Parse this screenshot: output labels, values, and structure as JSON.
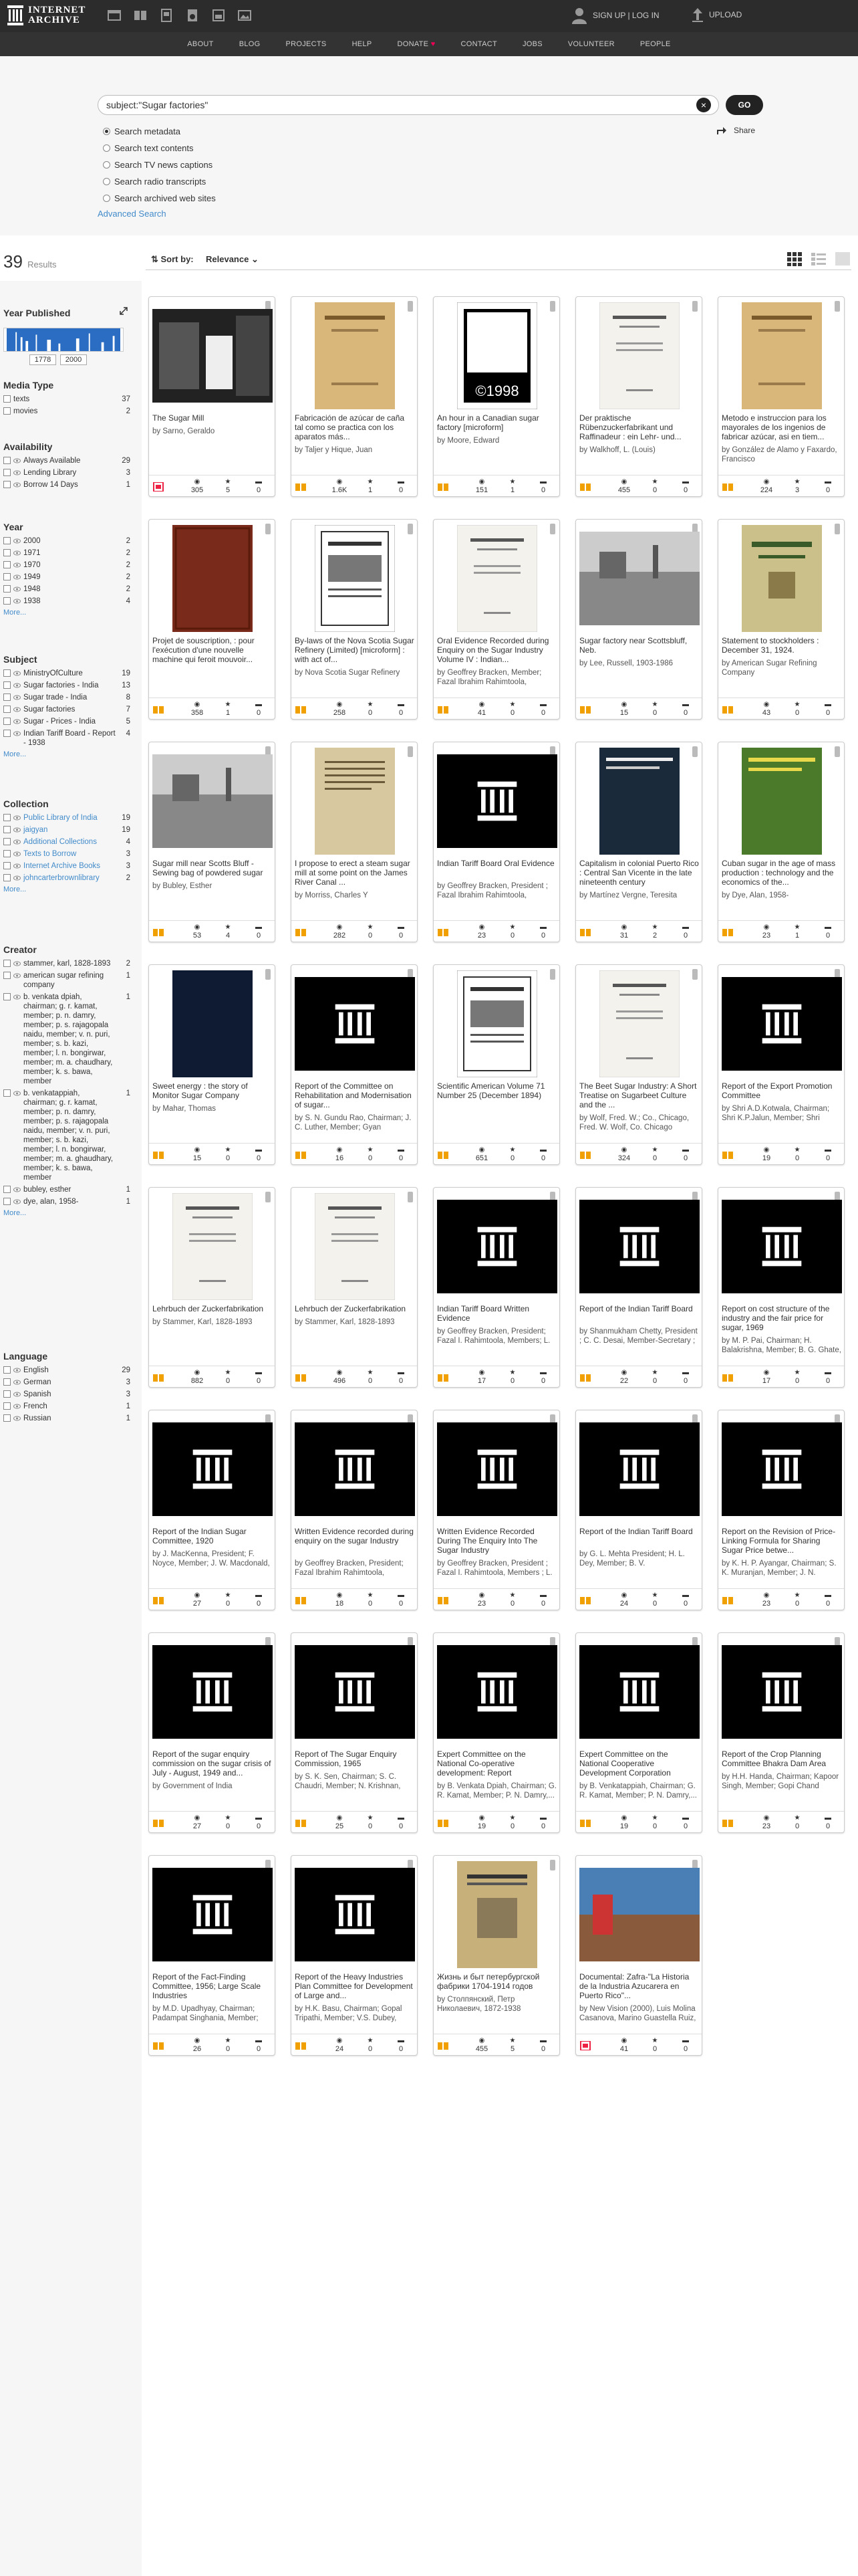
{
  "header": {
    "logo_line1": "INTERNET",
    "logo_line2": "ARCHIVE",
    "signup": "SIGN UP | LOG IN",
    "upload": "UPLOAD",
    "nav": [
      "ABOUT",
      "BLOG",
      "PROJECTS",
      "HELP",
      "DONATE",
      "CONTACT",
      "JOBS",
      "VOLUNTEER",
      "PEOPLE"
    ]
  },
  "search": {
    "query": "subject:\"Sugar factories\"",
    "go": "GO",
    "options": [
      "Search metadata",
      "Search text contents",
      "Search TV news captions",
      "Search radio transcripts",
      "Search archived web sites"
    ],
    "advanced": "Advanced Search",
    "share": "Share"
  },
  "results": {
    "count": "39",
    "label": "Results"
  },
  "sort": {
    "label": "Sort by:",
    "value": "Relevance"
  },
  "facets": {
    "year_published": {
      "title": "Year Published",
      "from": "1778",
      "to": "2000"
    },
    "media_type": {
      "title": "Media Type",
      "items": [
        {
          "label": "texts",
          "count": "37"
        },
        {
          "label": "movies",
          "count": "2"
        }
      ]
    },
    "availability": {
      "title": "Availability",
      "items": [
        {
          "label": "Always Available",
          "count": "29"
        },
        {
          "label": "Lending Library",
          "count": "3"
        },
        {
          "label": "Borrow 14 Days",
          "count": "1"
        }
      ]
    },
    "year": {
      "title": "Year",
      "items": [
        {
          "label": "2000",
          "count": "2"
        },
        {
          "label": "1971",
          "count": "2"
        },
        {
          "label": "1970",
          "count": "2"
        },
        {
          "label": "1949",
          "count": "2"
        },
        {
          "label": "1948",
          "count": "2"
        },
        {
          "label": "1938",
          "count": "4"
        }
      ],
      "more": "More..."
    },
    "subject": {
      "title": "Subject",
      "items": [
        {
          "label": "MinistryOfCulture",
          "count": "19"
        },
        {
          "label": "Sugar factories - India",
          "count": "13"
        },
        {
          "label": "Sugar trade - India",
          "count": "8"
        },
        {
          "label": "Sugar factories",
          "count": "7"
        },
        {
          "label": "Sugar - Prices - India",
          "count": "5"
        },
        {
          "label": "Indian Tariff Board - Report - 1938",
          "count": "4"
        }
      ],
      "more": "More..."
    },
    "collection": {
      "title": "Collection",
      "items": [
        {
          "label": "Public Library of India",
          "count": "19"
        },
        {
          "label": "jaigyan",
          "count": "19"
        },
        {
          "label": "Additional Collections",
          "count": "4"
        },
        {
          "label": "Texts to Borrow",
          "count": "3"
        },
        {
          "label": "Internet Archive Books",
          "count": "3"
        },
        {
          "label": "johncarterbrownlibrary",
          "count": "2"
        }
      ],
      "more": "More..."
    },
    "creator": {
      "title": "Creator",
      "items": [
        {
          "label": "stammer, karl, 1828-1893",
          "count": "2"
        },
        {
          "label": "american sugar refining company",
          "count": "1"
        },
        {
          "label": "b. venkata dpiah, chairman; g. r. kamat, member; p. n. damry, member; p. s. rajagopala naidu, member; v. n. puri, member; s. b. kazi, member; l. n. bongirwar, member; m. a. chaudhary, member; k. s. bawa, member",
          "count": "1"
        },
        {
          "label": "b. venkatappiah, chairman; g. r. kamat, member; p. n. damry, member; p. s. rajagopala naidu, member; v. n. puri, member; s. b. kazi, member; l. n. bongirwar, member; m. a. ghaudhary, member; k. s. bawa, member",
          "count": "1"
        },
        {
          "label": "bubley, esther",
          "count": "1"
        },
        {
          "label": "dye, alan, 1958-",
          "count": "1"
        }
      ],
      "more": "More..."
    },
    "language": {
      "title": "Language",
      "items": [
        {
          "label": "English",
          "count": "29"
        },
        {
          "label": "German",
          "count": "3"
        },
        {
          "label": "Spanish",
          "count": "3"
        },
        {
          "label": "French",
          "count": "1"
        },
        {
          "label": "Russian",
          "count": "1"
        }
      ]
    }
  },
  "items": [
    {
      "title": "The Sugar Mill",
      "by": "by Sarno, Geraldo",
      "views": "305",
      "favs": "5",
      "reviews": "0",
      "type": "movie",
      "thumb": "photo-dark"
    },
    {
      "title": "Fabricación de azúcar de caña tal como se practica con los aparatos más...",
      "by": "by Taljer y Hique, Juan",
      "views": "1.6K",
      "favs": "1",
      "reviews": "0",
      "type": "text",
      "thumb": "book-tan"
    },
    {
      "title": "An hour in a Canadian sugar factory [microform]",
      "by": "by Moore, Edward",
      "views": "151",
      "favs": "1",
      "reviews": "0",
      "type": "text",
      "thumb": "copyright"
    },
    {
      "title": "Der praktische Rübenzuckerfabrikant und Raffinadeur : ein Lehr- und...",
      "by": "by Walkhoff, L. (Louis)",
      "views": "455",
      "favs": "0",
      "reviews": "0",
      "type": "text",
      "thumb": "page-white"
    },
    {
      "title": "Metodo e instruccion para los mayorales de los ingenios de fabricar azúcar, asi en tiem...",
      "by": "by González de Alamo y Faxardo, Francisco",
      "views": "224",
      "favs": "3",
      "reviews": "0",
      "type": "text",
      "thumb": "book-tan"
    },
    {
      "title": "Projet de souscription, : pour l'exécution d'une nouvelle machine qui feroit mouvoir...",
      "by": "",
      "views": "358",
      "favs": "1",
      "reviews": "0",
      "type": "text",
      "thumb": "book-red"
    },
    {
      "title": "By-laws of the Nova Scotia Sugar Refinery (Limited) [microform] : with act of...",
      "by": "by Nova Scotia Sugar Refinery",
      "views": "258",
      "favs": "0",
      "reviews": "0",
      "type": "text",
      "thumb": "page-bw"
    },
    {
      "title": "Oral Evidence Recorded during Enquiry on the Sugar Industry Volume IV : Indian...",
      "by": "by Geoffrey Bracken, Member; Fazal Ibrahim Rahimtoola, Member; L. C...",
      "views": "41",
      "favs": "0",
      "reviews": "0",
      "type": "text",
      "thumb": "page-white"
    },
    {
      "title": "Sugar factory near Scottsbluff, Neb.",
      "by": "by Lee, Russell, 1903-1986",
      "views": "15",
      "favs": "0",
      "reviews": "0",
      "type": "text",
      "thumb": "photo-gray"
    },
    {
      "title": "Statement to stockholders : December 31, 1924.",
      "by": "by American Sugar Refining Company",
      "views": "43",
      "favs": "0",
      "reviews": "0",
      "type": "text",
      "thumb": "book-olive"
    },
    {
      "title": "Sugar mill near Scotts Bluff - Sewing bag of powdered sugar",
      "by": "by Bubley, Esther",
      "views": "53",
      "favs": "4",
      "reviews": "0",
      "type": "text",
      "thumb": "photo-gray"
    },
    {
      "title": "I propose to erect a steam sugar mill at some point on the James River Canal ...",
      "by": "by Morriss, Charles Y",
      "views": "282",
      "favs": "0",
      "reviews": "0",
      "type": "text",
      "thumb": "page-aged"
    },
    {
      "title": "Indian Tariff Board Oral Evidence",
      "by": "by Geoffrey Bracken, President ; Fazal Ibrahim Rahimtoola, Member; L. C...",
      "views": "23",
      "favs": "0",
      "reviews": "0",
      "type": "text",
      "thumb": "archive"
    },
    {
      "title": "Capitalism in colonial Puerto Rico : Central San Vicente in the late nineteenth century",
      "by": "by Martínez Vergne, Teresita",
      "views": "31",
      "favs": "2",
      "reviews": "0",
      "type": "text",
      "thumb": "book-dark"
    },
    {
      "title": "Cuban sugar in the age of mass production : technology and the economics of the...",
      "by": "by Dye, Alan, 1958-",
      "views": "23",
      "favs": "1",
      "reviews": "0",
      "type": "text",
      "thumb": "book-green"
    },
    {
      "title": "Sweet energy : the story of Monitor Sugar Company",
      "by": "by Mahar, Thomas",
      "views": "15",
      "favs": "0",
      "reviews": "0",
      "type": "text",
      "thumb": "book-navy"
    },
    {
      "title": "Report of the Committee on Rehabilitation and Modernisation of sugar...",
      "by": "by S. N. Gundu Rao, Chairman; J. C. Luther, Member; Gyan Chandra,...",
      "views": "16",
      "favs": "0",
      "reviews": "0",
      "type": "text",
      "thumb": "archive"
    },
    {
      "title": "Scientific American Volume 71 Number 25 (December 1894)",
      "by": "",
      "views": "651",
      "favs": "0",
      "reviews": "0",
      "type": "text",
      "thumb": "page-bw"
    },
    {
      "title": "The Beet Sugar Industry: A Short Treatise on Sugarbeet Culture and the ...",
      "by": "by Wolf, Fred. W.; Co., Chicago, Fred. W. Wolf, Co. Chicago",
      "views": "324",
      "favs": "0",
      "reviews": "0",
      "type": "text",
      "thumb": "page-white"
    },
    {
      "title": "Report of the Export Promotion Committee",
      "by": "by Shri A.D.Kotwala, Chairman; Shri K.P.Jalun, Member; Shri Debes...",
      "views": "19",
      "favs": "0",
      "reviews": "0",
      "type": "text",
      "thumb": "archive"
    },
    {
      "title": "Lehrbuch der Zuckerfabrikation",
      "by": "by Stammer, Karl, 1828-1893",
      "views": "882",
      "favs": "0",
      "reviews": "0",
      "type": "text",
      "thumb": "page-white"
    },
    {
      "title": "Lehrbuch der Zuckerfabrikation",
      "by": "by Stammer, Karl, 1828-1893",
      "views": "496",
      "favs": "0",
      "reviews": "0",
      "type": "text",
      "thumb": "page-white"
    },
    {
      "title": "Indian Tariff Board Written Evidence",
      "by": "by Geoffrey Bracken, President; Fazal I. Rahimtoola, Members; L. C...",
      "views": "17",
      "favs": "0",
      "reviews": "0",
      "type": "text",
      "thumb": "archive"
    },
    {
      "title": "Report of the Indian Tariff Board",
      "by": "by Shanmukham Chetty, President ; C. C. Desai, Member-Secretary ; H.L.De...",
      "views": "22",
      "favs": "0",
      "reviews": "0",
      "type": "text",
      "thumb": "archive"
    },
    {
      "title": "Report on cost structure of the industry and the fair price for sugar, 1969",
      "by": "by M. P. Pai, Chairman; H. Balakrishna, Member; B. G. Ghate, Member; M. Zaheer...",
      "views": "17",
      "favs": "0",
      "reviews": "0",
      "type": "text",
      "thumb": "archive"
    },
    {
      "title": "Report of the Indian Sugar Committee, 1920",
      "by": "by J. MacKenna, President; F. Noyce, Member; J. W. Macdonald, Member; W. W...",
      "views": "27",
      "favs": "0",
      "reviews": "0",
      "type": "text",
      "thumb": "archive"
    },
    {
      "title": "Written Evidence recorded during enquiry on the sugar Industry",
      "by": "by Geoffrey Bracken, President; Fazal Ibrahim Rahimtoola, Members; L. C...",
      "views": "18",
      "favs": "0",
      "reviews": "0",
      "type": "text",
      "thumb": "archive"
    },
    {
      "title": "Written Evidence Recorded During The Enquiry Into The Sugar Industry",
      "by": "by Geoffrey Bracken, President ; Fazal I. Rahimtoola, Members ; L. ...",
      "views": "23",
      "favs": "0",
      "reviews": "0",
      "type": "text",
      "thumb": "archive"
    },
    {
      "title": "Report of the Indian Tariff Board",
      "by": "by G. L. Mehta President; H. L. Dey, Member; B. V. Narayanaswamy Naidu, ...",
      "views": "24",
      "favs": "0",
      "reviews": "0",
      "type": "text",
      "thumb": "archive"
    },
    {
      "title": "Report on the Revision of Price-Linking Formula for Sharing Sugar Price betwe...",
      "by": "by K. H. P. Ayangar, Chairman; S. K. Muranjan, Member; J. N. Dutta,...",
      "views": "23",
      "favs": "0",
      "reviews": "0",
      "type": "text",
      "thumb": "archive"
    },
    {
      "title": "Report of the sugar enquiry commission on the sugar crisis of July - August, 1949 and...",
      "by": "by Government of India",
      "views": "27",
      "favs": "0",
      "reviews": "0",
      "type": "text",
      "thumb": "archive"
    },
    {
      "title": "Report of The Sugar Enquiry Commission, 1965",
      "by": "by S. K. Sen, Chairman; S. C. Chaudri, Member; N. Krishnan, Member; Dharm...",
      "views": "25",
      "favs": "0",
      "reviews": "0",
      "type": "text",
      "thumb": "archive"
    },
    {
      "title": "Expert Committee on the National Co-operative development: Report",
      "by": "by B. Venkata Dpiah, Chairman; G. R. Kamat, Member; P. N. Damry,...",
      "views": "19",
      "favs": "0",
      "reviews": "0",
      "type": "text",
      "thumb": "archive"
    },
    {
      "title": "Expert Committee on the National Cooperative Development Corporation",
      "by": "by B. Venkatappiah, Chairman; G. R. Kamat, Member; P. N. Damry,...",
      "views": "19",
      "favs": "0",
      "reviews": "0",
      "type": "text",
      "thumb": "archive"
    },
    {
      "title": "Report of the Crop Planning Committee Bhakra Dam Area",
      "by": "by H.H. Handa, Chairman; Kapoor Singh, Member; Gopi Chand Gupta, Member;...",
      "views": "23",
      "favs": "0",
      "reviews": "0",
      "type": "text",
      "thumb": "archive"
    },
    {
      "title": "Report of the Fact-Finding Committee, 1956; Large Scale Industries",
      "by": "by M.D. Upadhyay, Chairman; Padampat Singhania, Member; R.P....",
      "views": "26",
      "favs": "0",
      "reviews": "0",
      "type": "text",
      "thumb": "archive"
    },
    {
      "title": "Report of the Heavy Industries Plan Committee for Development of Large and...",
      "by": "by H.K. Basu, Chairman; Gopal Tripathi, Member; V.S. Dubey, Member; S.C.L. Jai...",
      "views": "24",
      "favs": "0",
      "reviews": "0",
      "type": "text",
      "thumb": "archive"
    },
    {
      "title": "Жизнь и быт петербургской фабрики 1704-1914 годов",
      "by": "by Столпянский, Петр Николаевич, 1872-1938",
      "views": "455",
      "favs": "5",
      "reviews": "0",
      "type": "text",
      "thumb": "book-cyr"
    },
    {
      "title": "Documental: Zafra-\"La Historia de la Industria Azucarera en Puerto Rico\"...",
      "by": "by New Vision (2000), Luis Molina Casanova, Marino Guastella Ruiz, Jesse...",
      "views": "41",
      "favs": "0",
      "reviews": "0",
      "type": "movie",
      "thumb": "photo-color"
    }
  ]
}
